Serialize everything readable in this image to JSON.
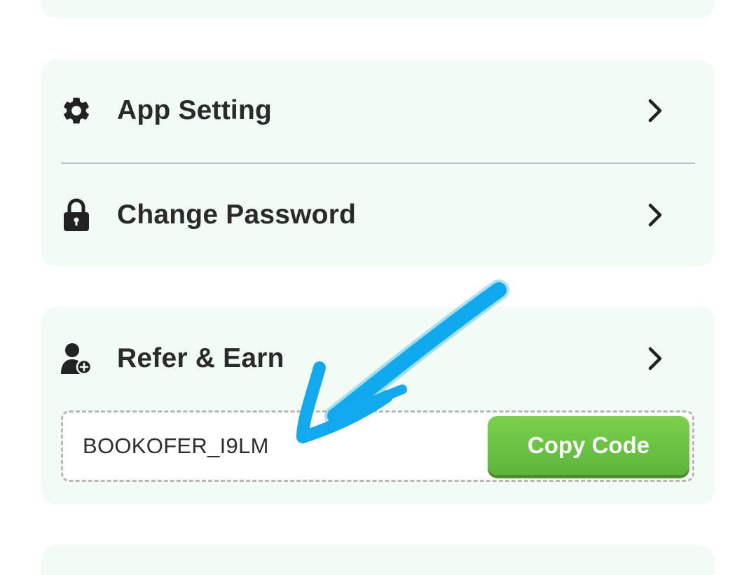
{
  "menu": {
    "app_setting": {
      "label": "App Setting",
      "icon": "gear-icon"
    },
    "change_password": {
      "label": "Change Password",
      "icon": "lock-icon"
    }
  },
  "refer": {
    "label": "Refer & Earn",
    "icon": "user-add-icon",
    "code": "BOOKOFER_I9LM",
    "copy_label": "Copy Code"
  },
  "colors": {
    "card_bg": "#f2fcf4",
    "text": "#2a2a2a",
    "button_green": "#6cc244",
    "annotation_arrow": "#12a9ef"
  }
}
